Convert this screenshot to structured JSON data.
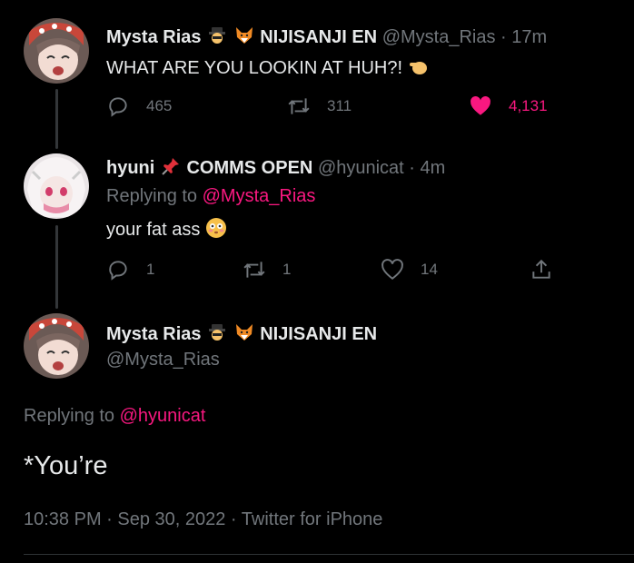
{
  "tweet1": {
    "name": "Mysta Rias",
    "badges": [
      "detective-emoji",
      "fox-emoji"
    ],
    "org": "NIJISANJI EN",
    "handle": "@Mysta_Rias",
    "sep": "·",
    "time": "17m",
    "text": "WHAT ARE YOU LOOKIN AT HUH?!",
    "text_emoji": "pointing-hand-emoji",
    "replies": "465",
    "retweets": "311",
    "likes": "4,131",
    "liked": true
  },
  "tweet2": {
    "name": "hyuni",
    "pin_emoji": "pushpin-emoji",
    "status": "COMMS OPEN",
    "handle": "@hyunicat",
    "sep": "·",
    "time": "4m",
    "replying_prefix": "Replying to",
    "replying_to": "@Mysta_Rias",
    "text": "your fat ass",
    "text_emoji": "flushed-emoji",
    "replies": "1",
    "retweets": "1",
    "likes": "14"
  },
  "tweet3": {
    "name": "Mysta Rias",
    "badges": [
      "detective-emoji",
      "fox-emoji"
    ],
    "org": "NIJISANJI EN",
    "handle": "@Mysta_Rias",
    "replying_prefix": "Replying to",
    "replying_to": "@hyunicat",
    "text": "*You’re",
    "timestamp": "10:38 PM · Sep 30, 2022 · Twitter for iPhone"
  },
  "colors": {
    "background": "#000000",
    "text": "#e7e9ea",
    "secondary": "#71767b",
    "accent_pink": "#f91880"
  }
}
